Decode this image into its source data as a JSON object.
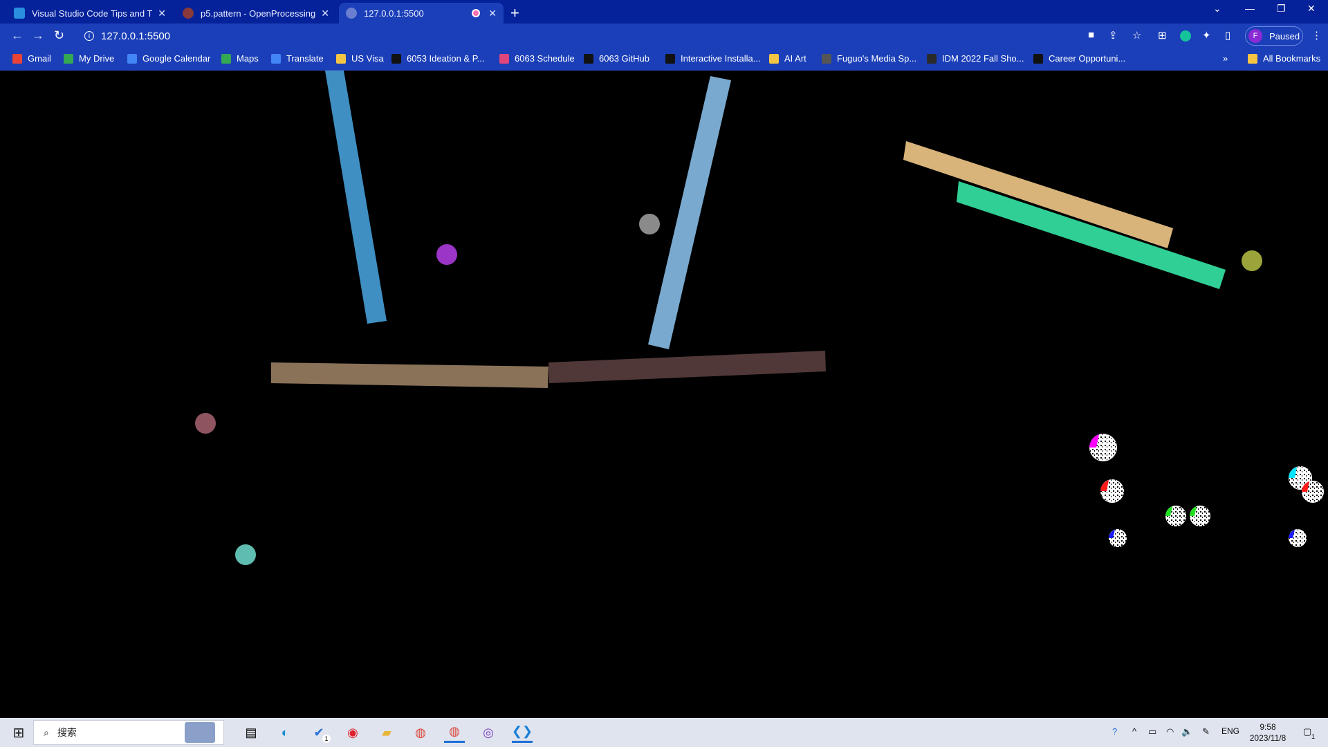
{
  "browser": {
    "tabs": [
      {
        "title": "Visual Studio Code Tips and T",
        "favicon": "vscode-icon",
        "active": false
      },
      {
        "title": "p5.pattern - OpenProcessing",
        "favicon": "openprocessing-icon",
        "active": false
      },
      {
        "title": "127.0.0.1:5500",
        "favicon": "globe-icon",
        "active": true
      }
    ],
    "address": "127.0.0.1:5500",
    "profile_label": "Paused",
    "profile_initial": "F",
    "bookmarks": [
      {
        "label": "Gmail",
        "icon": "gmail-icon",
        "color": "#ea4335"
      },
      {
        "label": "My Drive",
        "icon": "drive-icon",
        "color": "#34a853"
      },
      {
        "label": "Google Calendar",
        "icon": "calendar-icon",
        "color": "#4285f4"
      },
      {
        "label": "Maps",
        "icon": "maps-icon",
        "color": "#34a853"
      },
      {
        "label": "Translate",
        "icon": "translate-icon",
        "color": "#4285f4"
      },
      {
        "label": "US Visa",
        "icon": "folder-icon",
        "color": "#f4c542"
      },
      {
        "label": "6053 Ideation & P...",
        "icon": "dark-square-icon",
        "color": "#111"
      },
      {
        "label": "6063 Schedule",
        "icon": "schedule-icon",
        "color": "#e0457b"
      },
      {
        "label": "6063 GitHub",
        "icon": "github-icon",
        "color": "#111"
      },
      {
        "label": "Interactive Installa...",
        "icon": "github-icon",
        "color": "#111"
      },
      {
        "label": "AI Art",
        "icon": "folder-icon",
        "color": "#f4c542"
      },
      {
        "label": "Fuguo's Media Sp...",
        "icon": "cube-icon",
        "color": "#555"
      },
      {
        "label": "IDM 2022 Fall Sho...",
        "icon": "idm-icon",
        "color": "#2a2a2a"
      },
      {
        "label": "Career Opportuni...",
        "icon": "dark-square-icon",
        "color": "#111"
      }
    ],
    "all_bookmarks_label": "All Bookmarks",
    "overflow_label": "»"
  },
  "sketch": {
    "bars": [
      {
        "name": "bar-blue-left",
        "color": "#3f8fc3"
      },
      {
        "name": "bar-lightblue-right",
        "color": "#79a9ce"
      },
      {
        "name": "bar-tan",
        "color": "#d8b47a"
      },
      {
        "name": "bar-green",
        "color": "#2fcf95"
      },
      {
        "name": "bar-brown-left",
        "color": "#8a7259"
      },
      {
        "name": "bar-darkbrown-right",
        "color": "#503838"
      }
    ],
    "balls": [
      {
        "name": "ball-purple",
        "color": "#9a35c8"
      },
      {
        "name": "ball-gray",
        "color": "#8a8a8a"
      },
      {
        "name": "ball-olive",
        "color": "#9aa43a"
      },
      {
        "name": "ball-mauve",
        "color": "#8e5561"
      },
      {
        "name": "ball-teal",
        "color": "#5ebdb0"
      }
    ],
    "sparkle_balls": [
      {
        "name": "sparkle-magenta",
        "color": "#ff00ff"
      },
      {
        "name": "sparkle-red-1",
        "color": "#ff1a1a"
      },
      {
        "name": "sparkle-green-1",
        "color": "#22e022"
      },
      {
        "name": "sparkle-green-2",
        "color": "#22e022"
      },
      {
        "name": "sparkle-blue-1",
        "color": "#1a1aff"
      },
      {
        "name": "sparkle-cyan",
        "color": "#00e5ff"
      },
      {
        "name": "sparkle-red-2",
        "color": "#ff1a1a"
      },
      {
        "name": "sparkle-blue-2",
        "color": "#1a1aff"
      }
    ]
  },
  "taskbar": {
    "search_placeholder": "搜索",
    "apps": [
      "widgets-icon",
      "task-view-icon",
      "edge-icon",
      "todo-icon",
      "netease-music-icon",
      "file-explorer-icon",
      "chrome-icon",
      "chrome-profile-icon",
      "github-desktop-icon",
      "vscode-icon"
    ],
    "todo_badge": "1",
    "language": "ENG",
    "time": "9:58",
    "date": "2023/11/8",
    "notification_count": "1"
  }
}
